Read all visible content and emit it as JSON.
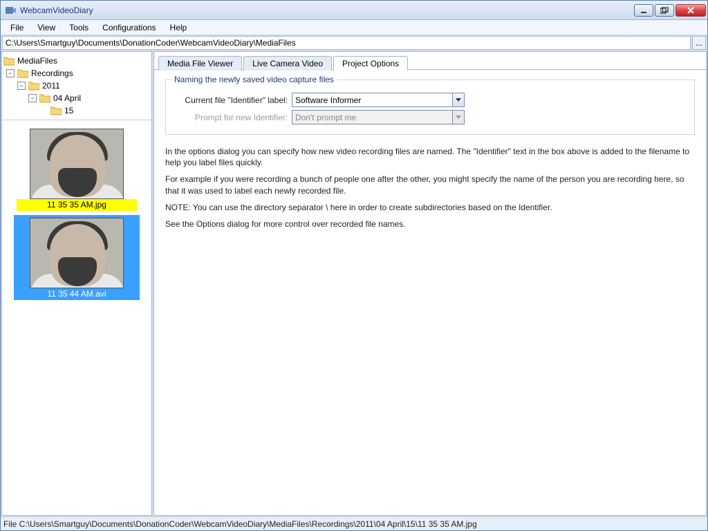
{
  "window": {
    "title": "WebcamVideoDiary"
  },
  "menu": {
    "items": [
      "File",
      "View",
      "Tools",
      "Configurations",
      "Help"
    ]
  },
  "pathbar": {
    "value": "C:\\Users\\Smartguy\\Documents\\DonationCoder\\WebcamVideoDiary\\MediaFiles",
    "more": "..."
  },
  "tree": {
    "root": "MediaFiles",
    "l1": "Recordings",
    "l2": "2011",
    "l3": "04 April",
    "l4": "15"
  },
  "thumbs": [
    {
      "caption": "11 35 35 AM.jpg",
      "selected": false
    },
    {
      "caption": "11 35 44 AM.avi",
      "selected": true
    }
  ],
  "tabs": {
    "items": [
      "Media File Viewer",
      "Live Camera Video",
      "Project Options"
    ],
    "active": 2
  },
  "options": {
    "group_title": "Naming the newly saved video capture files",
    "label_identifier": "Current file \"Identifier\" label:",
    "value_identifier": "Software Informer",
    "label_prompt": "Prompt for new Identifier:",
    "value_prompt": "Don't prompt me",
    "info": {
      "p1": "In the options dialog you can specify how new video recording files are named.  The \"Identifier\" text in the box above is added to the filename to help you label files quickly.",
      "p2": "For example if you were recording a bunch of people one after the other, you might specify the name of the person you are recording here, so that it was used to label each newly recorded file.",
      "p3": "NOTE: You can use the directory separator \\ here in order to create subdirectories based on the Identifier.",
      "p4": "See the Options dialog for more control over recorded file names."
    }
  },
  "statusbar": {
    "text": "File C:\\Users\\Smartguy\\Documents\\DonationCoder\\WebcamVideoDiary\\MediaFiles\\Recordings\\2011\\04 April\\15\\11 35 35 AM.jpg"
  }
}
